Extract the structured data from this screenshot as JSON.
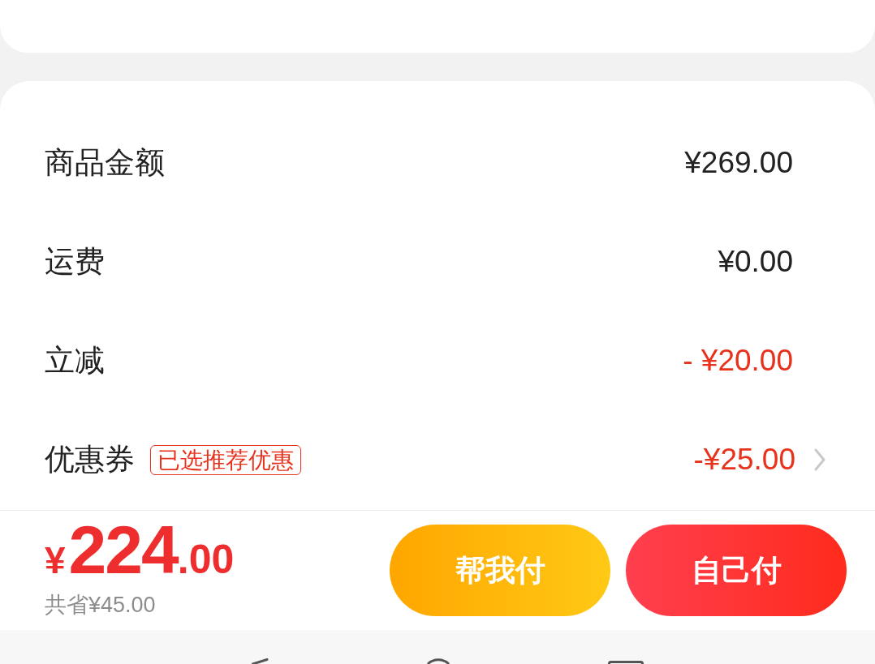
{
  "price_summary": {
    "rows": [
      {
        "label": "商品金额",
        "value": "¥269.00",
        "kind": "charge"
      },
      {
        "label": "运费",
        "value": "¥0.00",
        "kind": "charge"
      },
      {
        "label": "立减",
        "value": "- ¥20.00",
        "kind": "discount"
      },
      {
        "label": "优惠券",
        "tag": "已选推荐优惠",
        "value": "-¥25.00",
        "kind": "selectable"
      }
    ]
  },
  "checkout_bar": {
    "currency": "¥",
    "total_integer": "224",
    "total_decimal": ".00",
    "savings": "共省¥45.00",
    "buttons": [
      {
        "label": "帮我付",
        "kind": "friend_pay"
      },
      {
        "label": "自己付",
        "kind": "self_pay"
      }
    ]
  }
}
